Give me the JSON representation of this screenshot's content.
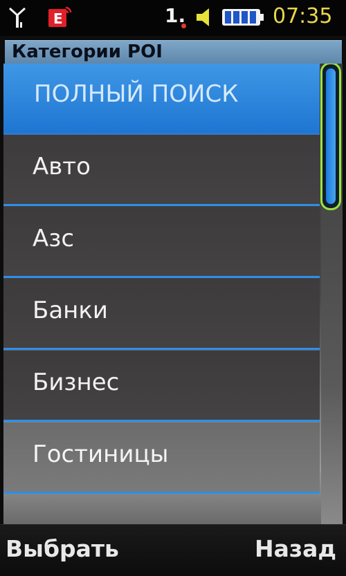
{
  "status_bar": {
    "line": "1.",
    "time": "07:35",
    "icons": [
      "signal-icon",
      "email-icon",
      "volume-icon",
      "battery-icon"
    ]
  },
  "title": "Категории POI",
  "list": {
    "items": [
      {
        "label": "ПОЛНЫЙ ПОИСК",
        "selected": true
      },
      {
        "label": "Авто",
        "selected": false
      },
      {
        "label": "Азс",
        "selected": false
      },
      {
        "label": "Банки",
        "selected": false
      },
      {
        "label": "Бизнес",
        "selected": false
      },
      {
        "label": "Гостиницы",
        "selected": false
      }
    ]
  },
  "softkeys": {
    "left": "Выбрать",
    "right": "Назад"
  },
  "colors": {
    "accent": "#2d8fe8",
    "selected": "#2f86dc",
    "scroll_border": "#9ee23f",
    "clock": "#e8d84a"
  }
}
